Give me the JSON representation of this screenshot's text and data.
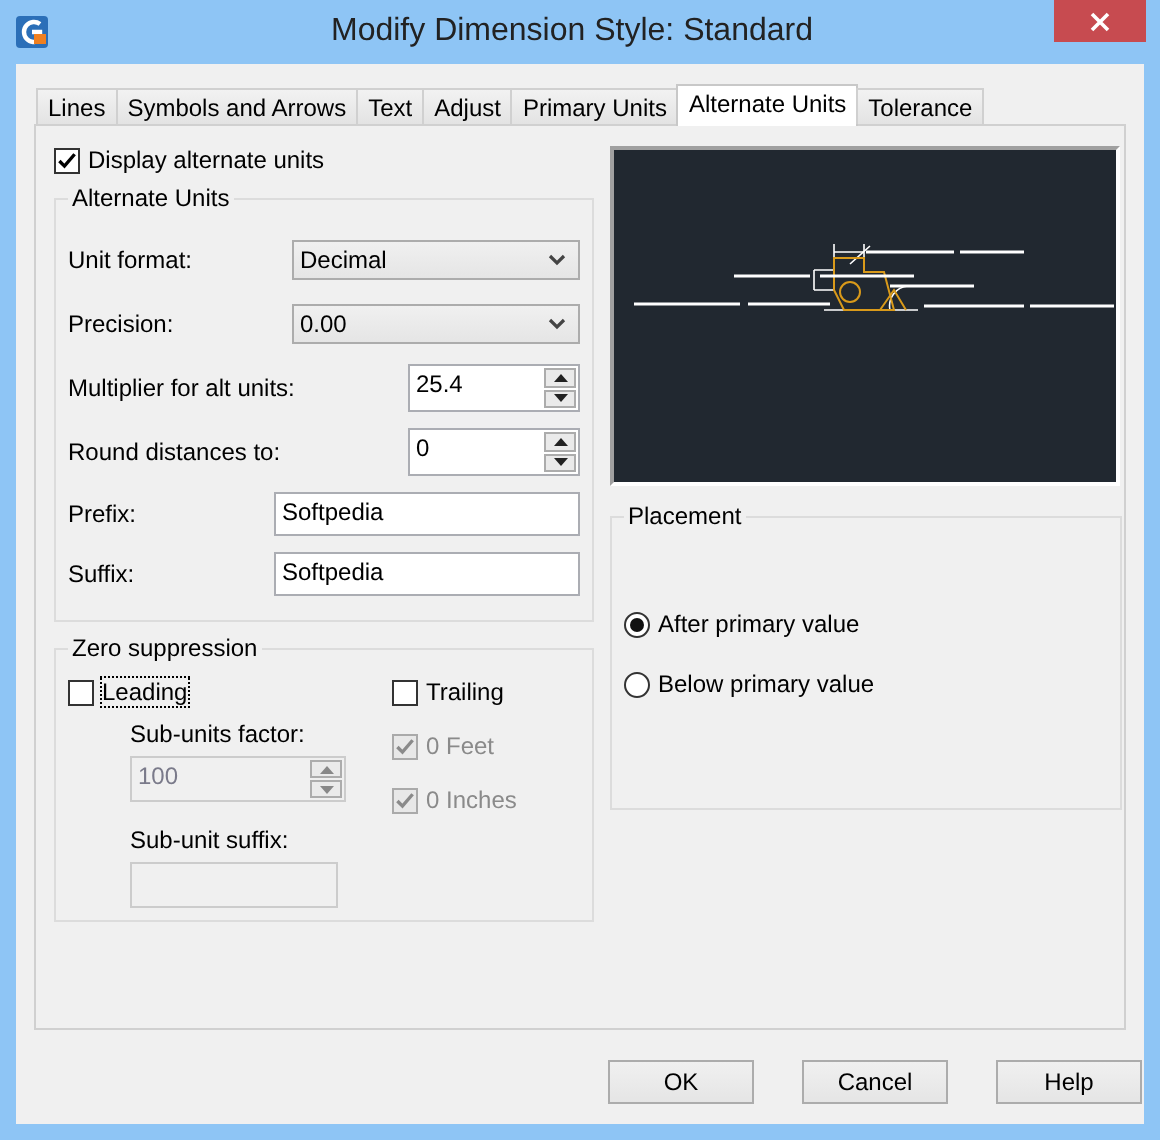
{
  "window": {
    "title": "Modify Dimension Style: Standard"
  },
  "tabs": [
    {
      "label": "Lines",
      "selected": false
    },
    {
      "label": "Symbols and Arrows",
      "selected": false
    },
    {
      "label": "Text",
      "selected": false
    },
    {
      "label": "Adjust",
      "selected": false
    },
    {
      "label": "Primary Units",
      "selected": false
    },
    {
      "label": "Alternate Units",
      "selected": true
    },
    {
      "label": "Tolerance",
      "selected": false
    }
  ],
  "display_alternate_units": {
    "label": "Display alternate units",
    "checked": true
  },
  "alternate_units": {
    "title": "Alternate Units",
    "fields": [
      {
        "kind": "dropdown",
        "label": "Unit format:",
        "value": "Decimal"
      },
      {
        "kind": "dropdown",
        "label": "Precision:",
        "value": "0.00"
      },
      {
        "kind": "spinner",
        "label": "Multiplier for alt units:",
        "value": "25.4"
      },
      {
        "kind": "spinner",
        "label": "Round distances  to:",
        "value": "0"
      },
      {
        "kind": "text",
        "label": "Prefix:",
        "value": "Softpedia"
      },
      {
        "kind": "text",
        "label": "Suffix:",
        "value": "Softpedia"
      }
    ]
  },
  "zero_suppression": {
    "title": "Zero suppression",
    "leading": {
      "label": "Leading",
      "checked": false
    },
    "trailing": {
      "label": "Trailing",
      "checked": false
    },
    "sub_units_factor": {
      "label": "Sub-units factor:",
      "value": "100",
      "disabled": true
    },
    "sub_unit_suffix": {
      "label": "Sub-unit suffix:",
      "disabled": true
    },
    "feet": {
      "label": "0 Feet",
      "checked": true,
      "disabled": true
    },
    "inches": {
      "label": "0 Inches",
      "checked": true,
      "disabled": true
    }
  },
  "placement": {
    "title": "Placement",
    "options": [
      {
        "label": "After primary value",
        "selected": true
      },
      {
        "label": "Below primary value",
        "selected": false
      }
    ]
  },
  "buttons": [
    "OK",
    "Cancel",
    "Help"
  ]
}
